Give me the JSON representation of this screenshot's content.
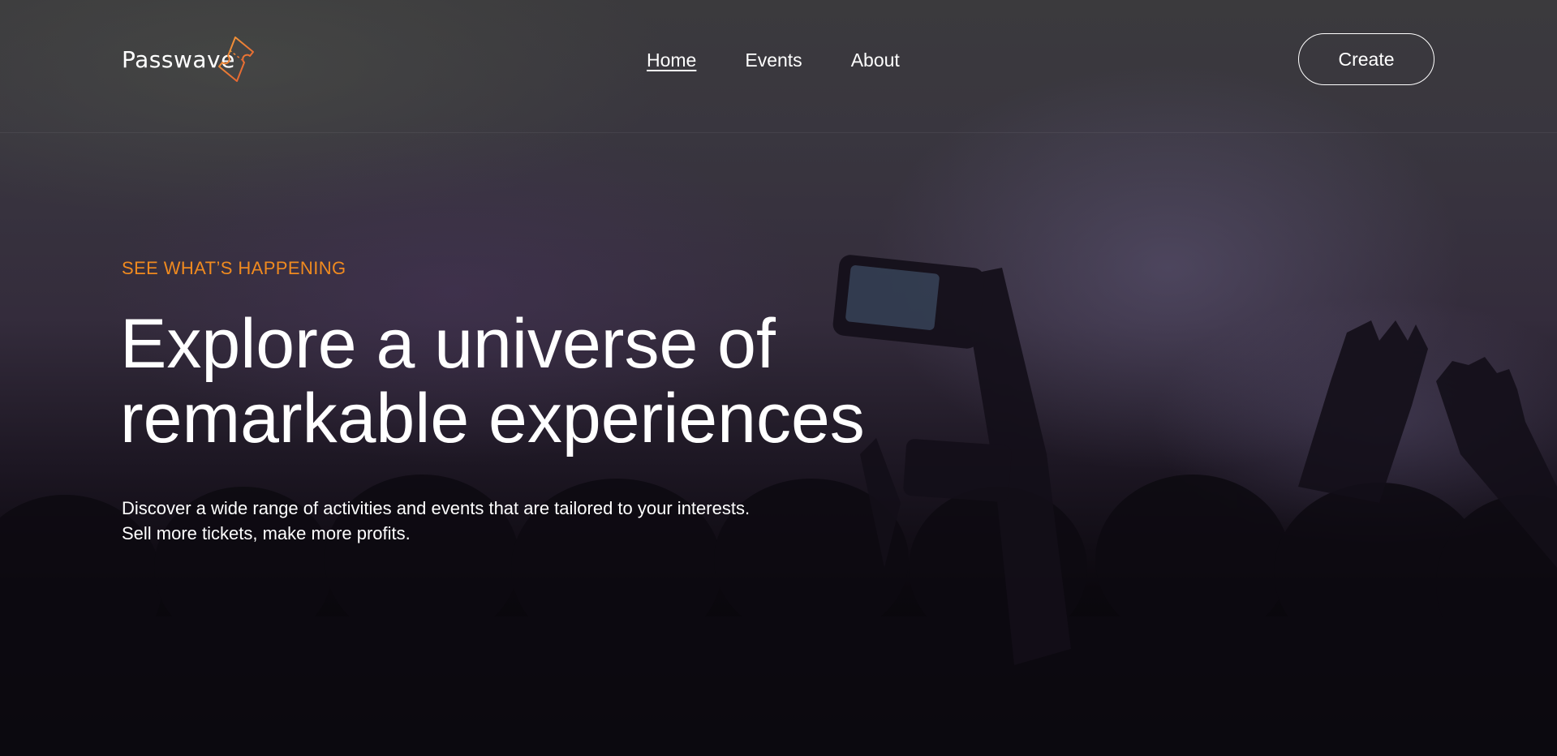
{
  "brand": {
    "name": "Passwave",
    "accent_color": "#f08a1f",
    "logo_icon": "ticket-icon"
  },
  "nav": {
    "items": [
      {
        "label": "Home",
        "active": true
      },
      {
        "label": "Events",
        "active": false
      },
      {
        "label": "About",
        "active": false
      }
    ]
  },
  "header": {
    "create_label": "Create"
  },
  "hero": {
    "eyebrow": "SEE WHAT’S HAPPENING",
    "headline_line1": "Explore a universe of",
    "headline_line2": "remarkable experiences",
    "subtext_line1": "Discover a wide range of activities and events that are tailored to your interests.",
    "subtext_line2": "Sell more tickets, make more profits.",
    "background": "concert-crowd-photo"
  }
}
